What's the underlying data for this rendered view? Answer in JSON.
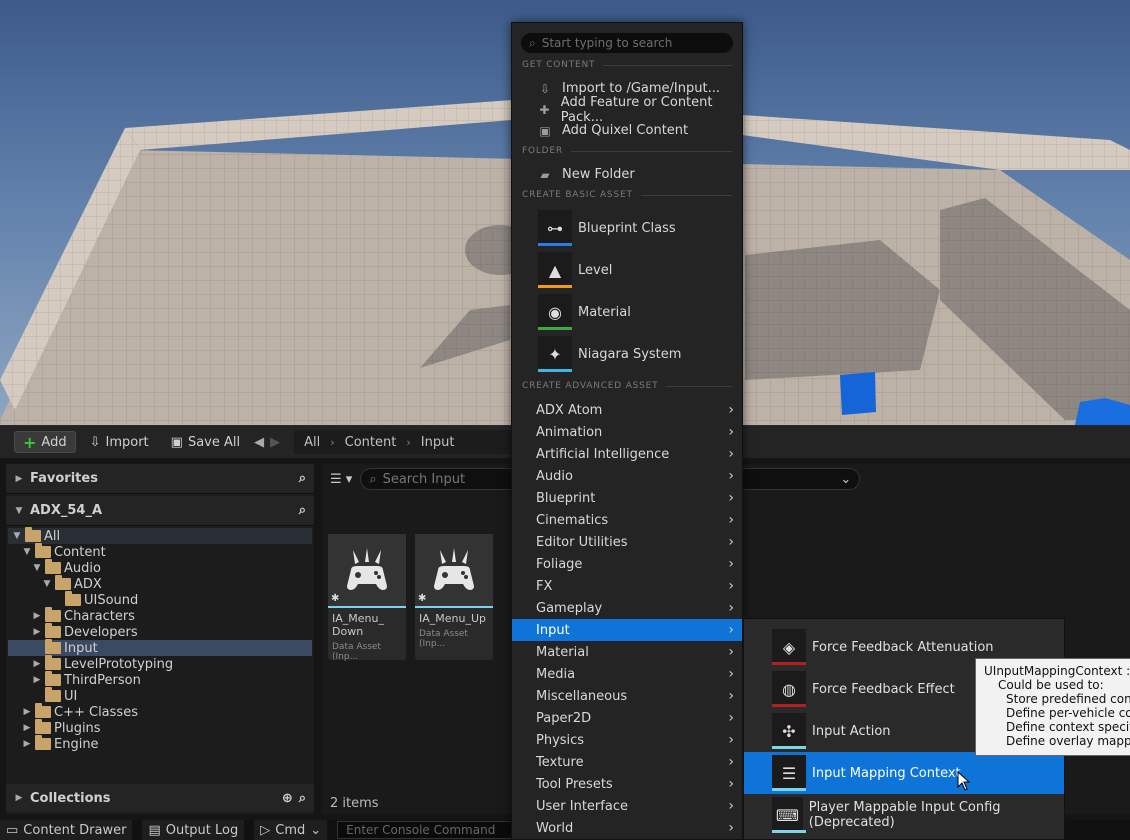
{
  "menu": {
    "search_placeholder": "Start typing to search",
    "sections": {
      "get_content": "GET CONTENT",
      "folder": "FOLDER",
      "basic": "CREATE BASIC ASSET",
      "advanced": "CREATE ADVANCED ASSET"
    },
    "get_content_items": [
      "Import to /Game/Input...",
      "Add Feature or Content Pack...",
      "Add Quixel Content"
    ],
    "new_folder": "New Folder",
    "basic_assets": [
      {
        "label": "Blueprint Class",
        "color": "#2d7bea"
      },
      {
        "label": "Level",
        "color": "#f29b1b"
      },
      {
        "label": "Material",
        "color": "#3cab3c"
      },
      {
        "label": "Niagara System",
        "color": "#3bb7e8"
      }
    ],
    "categories": [
      "ADX Atom",
      "Animation",
      "Artificial Intelligence",
      "Audio",
      "Blueprint",
      "Cinematics",
      "Editor Utilities",
      "Foliage",
      "FX",
      "Gameplay",
      "Input",
      "Material",
      "Media",
      "Miscellaneous",
      "Paper2D",
      "Physics",
      "Texture",
      "Tool Presets",
      "User Interface",
      "World"
    ],
    "active_category": "Input"
  },
  "submenu": {
    "items": [
      {
        "label": "Force Feedback Attenuation",
        "color": "#b32020"
      },
      {
        "label": "Force Feedback Effect",
        "color": "#b32020"
      },
      {
        "label": "Input Action",
        "color": "#7dd3e8"
      },
      {
        "label": "Input Mapping Context",
        "color": "#7dd3e8"
      },
      {
        "label": "Player Mappable Input Config (Deprecated)",
        "color": "#7dd3e8"
      }
    ],
    "active": "Input Mapping Context"
  },
  "tooltip": {
    "lines": [
      "UInputMappingContext : A c",
      "Could be used to:",
      "Store predefined controll",
      "Define per-vehicle contro",
      "Define context specific m",
      "Define overlay mappings"
    ]
  },
  "toolbar": {
    "add": "Add",
    "import": "Import",
    "save_all": "Save All",
    "breadcrumb": [
      "All",
      "Content",
      "Input"
    ]
  },
  "left_panel": {
    "favorites": "Favorites",
    "project": "ADX_54_A",
    "collections": "Collections",
    "tree": [
      {
        "label": "All",
        "level": 0,
        "arrow": "▼"
      },
      {
        "label": "Content",
        "level": 1,
        "arrow": "▼"
      },
      {
        "label": "Audio",
        "level": 2,
        "arrow": "▼"
      },
      {
        "label": "ADX",
        "level": 3,
        "arrow": "▼"
      },
      {
        "label": "UISound",
        "level": 4,
        "arrow": ""
      },
      {
        "label": "Characters",
        "level": 2,
        "arrow": "▶"
      },
      {
        "label": "Developers",
        "level": 2,
        "arrow": "▶"
      },
      {
        "label": "Input",
        "level": 2,
        "arrow": ""
      },
      {
        "label": "LevelPrototyping",
        "level": 2,
        "arrow": "▶"
      },
      {
        "label": "ThirdPerson",
        "level": 2,
        "arrow": "▶"
      },
      {
        "label": "UI",
        "level": 2,
        "arrow": ""
      },
      {
        "label": "C++ Classes",
        "level": 1,
        "arrow": "▶"
      },
      {
        "label": "Plugins",
        "level": 1,
        "arrow": "▶"
      },
      {
        "label": "Engine",
        "level": 1,
        "arrow": "▶"
      }
    ],
    "selected": "Input"
  },
  "right_panel": {
    "search_placeholder": "Search Input",
    "assets": [
      {
        "name": "IA_Menu_\nDown",
        "type": "Data Asset (Inp..."
      },
      {
        "name": "IA_Menu_Up",
        "type": "Data Asset (Inp..."
      }
    ],
    "items_count": "2 items"
  },
  "statusbar": {
    "content_drawer": "Content Drawer",
    "output_log": "Output Log",
    "cmd": "Cmd",
    "console_placeholder": "Enter Console Command"
  }
}
